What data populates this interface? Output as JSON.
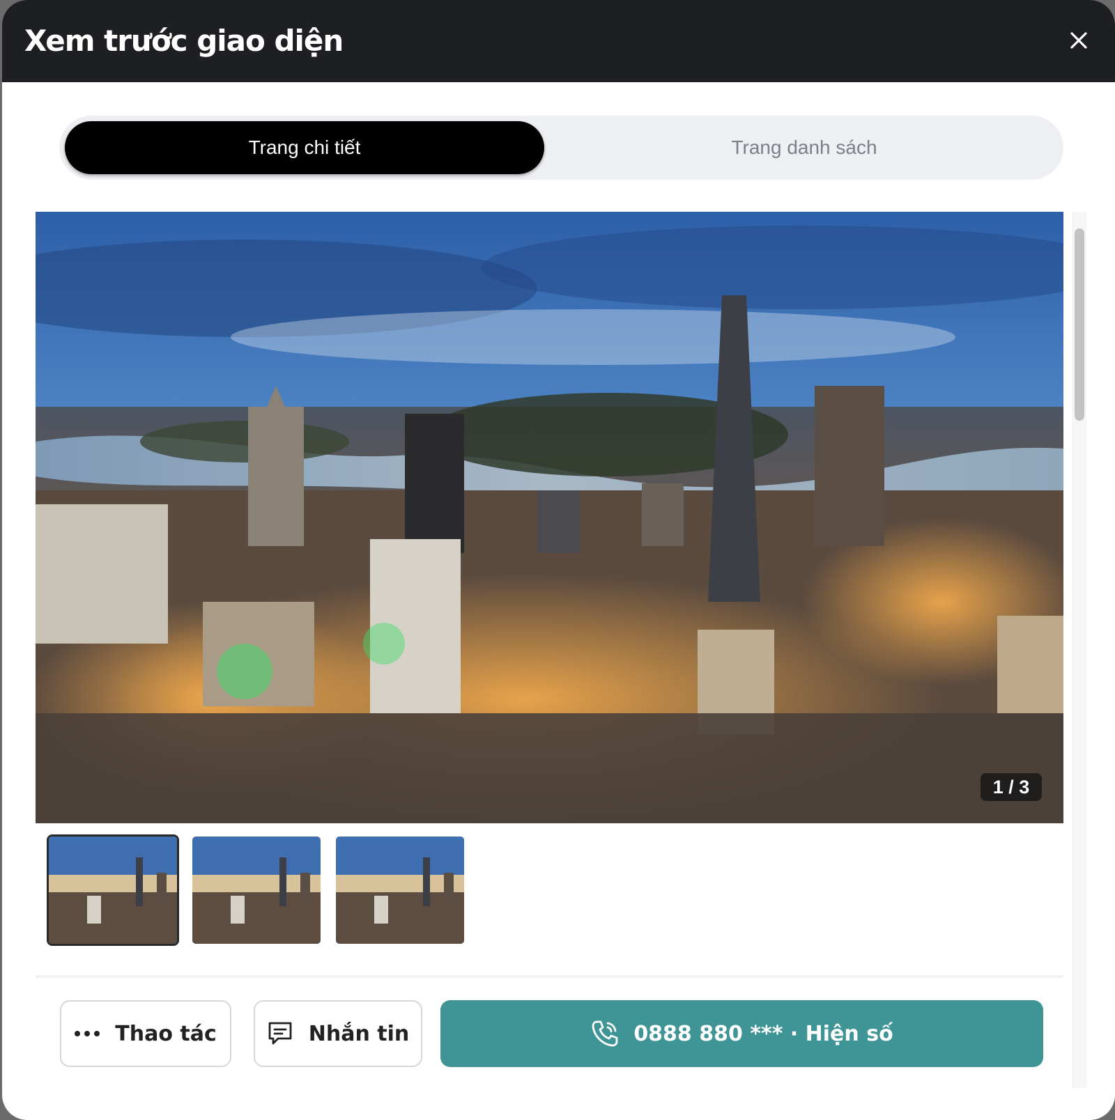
{
  "modal": {
    "title": "Xem trước giao diện",
    "close_icon": "close-icon"
  },
  "tabs": [
    {
      "label": "Trang chi tiết",
      "active": true
    },
    {
      "label": "Trang danh sách",
      "active": false
    }
  ],
  "gallery": {
    "counter": "1 / 3",
    "current_index": 1,
    "total": 3,
    "thumbnail_count": 3
  },
  "actions": {
    "more": {
      "label": "Thao tác",
      "icon": "more-dots-icon"
    },
    "chat": {
      "label": "Nhắn tin",
      "icon": "chat-icon"
    },
    "call": {
      "label": "0888 880 *** · Hiện số",
      "icon": "phone-icon"
    }
  },
  "colors": {
    "header_bg": "#1e1f22",
    "accent_call": "#3f9595",
    "tab_active_bg": "#000000"
  }
}
